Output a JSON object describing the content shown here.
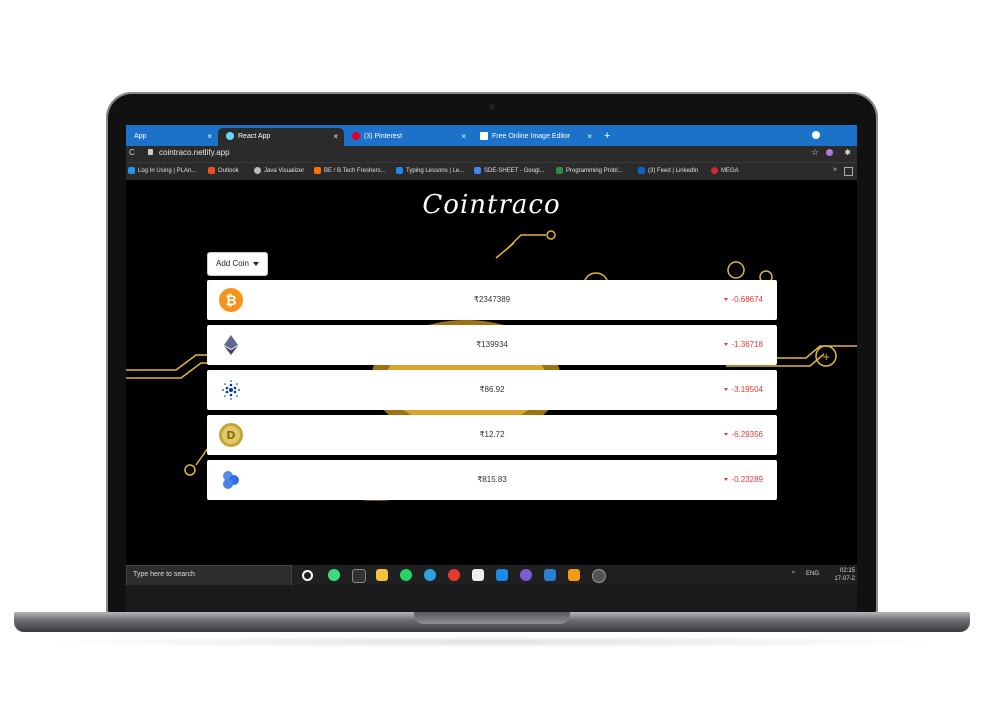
{
  "browser": {
    "tabs": [
      {
        "label": "App",
        "active": false,
        "icon_color": "#1c72c9"
      },
      {
        "label": "React App",
        "active": true,
        "icon_color": "#61dafb"
      },
      {
        "label": "(3) Pinterest",
        "active": false,
        "icon_color": "#e60023"
      },
      {
        "label": "Free Online Image Editor",
        "active": false,
        "icon_color": "#1c72c9"
      }
    ],
    "new_tab_glyph": "+",
    "close_glyph": "×",
    "address": {
      "url": "cointraco.netlify.app",
      "reload_glyph": "C"
    },
    "bookmarks": [
      {
        "label": "Log In Using | PLAn...",
        "color": "#2196f3"
      },
      {
        "label": "Outlook",
        "color": "#f25022"
      },
      {
        "label": "Java Visualizer",
        "color": "#bbbbbb"
      },
      {
        "label": "BE / B.Tech Freshers...",
        "color": "#ff6f00"
      },
      {
        "label": "Typing Lessons | Le...",
        "color": "#1e88e5"
      },
      {
        "label": "SDE-SHEET - Googl...",
        "color": "#4285f4"
      },
      {
        "label": "Programming Probl...",
        "color": "#2f8d46"
      },
      {
        "label": "(3) Feed | LinkedIn",
        "color": "#0a66c2"
      },
      {
        "label": "MEGA",
        "color": "#d9272e"
      }
    ],
    "bookmarks_more": "»"
  },
  "app": {
    "logo": "Cointraco",
    "add_coin_label": "Add Coin",
    "coins": [
      {
        "icon": "bitcoin-icon",
        "price": "₹2347389",
        "change": "-0.68674"
      },
      {
        "icon": "ethereum-icon",
        "price": "₹139934",
        "change": "-1.36718"
      },
      {
        "icon": "cardano-icon",
        "price": "₹86.92",
        "change": "-3.19504"
      },
      {
        "icon": "dogecoin-icon",
        "price": "₹12.72",
        "change": "-6.29356"
      },
      {
        "icon": "polygon-icon",
        "price": "₹815.83",
        "change": "-0.23289"
      }
    ],
    "colors": {
      "negative": "#e53935",
      "accent_gold": "#e3b53a"
    }
  },
  "taskbar": {
    "search_placeholder": "Type here to search",
    "tray_language": "ENG",
    "time": "02:15",
    "date": "17-07-2"
  }
}
